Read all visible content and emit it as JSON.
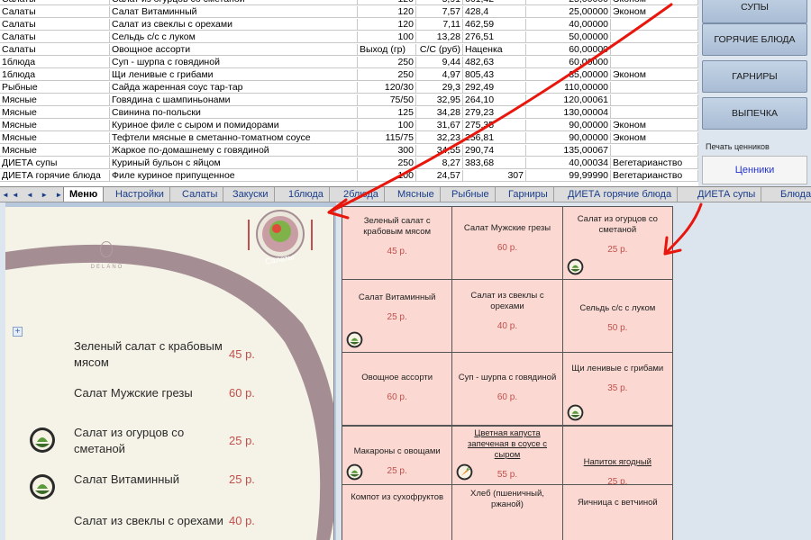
{
  "sheet": {
    "rows": [
      [
        "Салаты",
        "Салат из огурцов со сметаной",
        "120",
        "5,91",
        "661,42",
        "25,00000",
        "Эконом"
      ],
      [
        "Салаты",
        "Салат Витаминный",
        "120",
        "7,57",
        "428,4",
        "25,00000",
        "Эконом"
      ],
      [
        "Салаты",
        "Салат из свеклы с орехами",
        "120",
        "7,11",
        "462,59",
        "40,00000",
        ""
      ],
      [
        "Салаты",
        "Сельдь с/с с луком",
        "100",
        "13,28",
        "276,51",
        "50,00000",
        ""
      ],
      [
        "Салаты",
        "Овощное ассорти",
        "Выход (гр)",
        "С/С (руб)",
        "Наценка",
        "60,00000",
        ""
      ],
      [
        "1блюда",
        "Суп - шурпа с говядиной",
        "250",
        "9,44",
        "482,63",
        "60,00000",
        ""
      ],
      [
        "1блюда",
        "Щи ленивые с грибами",
        "250",
        "4,97",
        "805,43",
        "35,00000",
        "Эконом"
      ],
      [
        "Рыбные",
        "Сайда жаренная соус тар-тар",
        "120/30",
        "29,3",
        "292,49",
        "110,00000",
        ""
      ],
      [
        "Мясные",
        "Говядина с шампиньонами",
        "75/50",
        "32,95",
        "264,10",
        "120,00061",
        ""
      ],
      [
        "Мясные",
        "Свинина по-польски",
        "125",
        "34,28",
        "279,23",
        "130,00004",
        ""
      ],
      [
        "Мясные",
        "Куриное филе с сыром и помидорами",
        "100",
        "31,67",
        "275,35",
        "90,00000",
        "Эконом"
      ],
      [
        "Мясные",
        "Тефтели мясные в сметанно-томатном соусе",
        "115/75",
        "32,23",
        "256,81",
        "90,00000",
        "Эконом"
      ],
      [
        "Мясные",
        "Жаркое по-домашнему с говядиной",
        "300",
        "34,55",
        "290,74",
        "135,00067",
        ""
      ],
      [
        "ДИЕТА супы",
        "Куриный бульон с яйцом",
        "250",
        "8,27",
        "383,68",
        "40,00034",
        "Вегетарианство"
      ],
      [
        "ДИЕТА горячие блюда",
        "Филе куриное припущенное",
        "100",
        "24,57",
        "307",
        "99,99990",
        "Вегетарианство"
      ]
    ]
  },
  "side_buttons": [
    "СУПЫ",
    "ГОРЯЧИЕ БЛЮДА",
    "ГАРНИРЫ",
    "ВЫПЕЧКА"
  ],
  "price_tags": {
    "caption": "Печать ценников",
    "button": "Ценники"
  },
  "tabs": {
    "nav": "◄◄ ◄ ► ►►",
    "items": [
      "Меню",
      "Настройки",
      "Салаты",
      "Закуски",
      "1блюда",
      "2блюда",
      "Мясные",
      "Рыбные",
      "Гарниры",
      "ДИЕТА горячие блюда",
      "ДИЕТА супы",
      "Блюда"
    ],
    "active": "Меню"
  },
  "menu": {
    "logo_text": "DELANO",
    "badge": "Салаты",
    "items": [
      {
        "name": "Зеленый салат с крабовым мясом",
        "price": "45 р."
      },
      {
        "name": "Салат Мужские грезы",
        "price": "60 р."
      },
      {
        "name": "Салат из огурцов со сметаной",
        "price": "25 р."
      },
      {
        "name": "Салат Витаминный",
        "price": "25 р."
      },
      {
        "name": "Салат из свеклы с орехами",
        "price": "40 р."
      }
    ]
  },
  "cards_top": [
    {
      "name": "Зеленый салат с крабовым мясом",
      "price": "45 р."
    },
    {
      "name": "Салат Мужские грезы",
      "price": "60 р."
    },
    {
      "name": "Салат из огурцов со сметаной",
      "price": "25 р."
    },
    {
      "name": "Салат Витаминный",
      "price": "25 р."
    },
    {
      "name": "Салат из свеклы с орехами",
      "price": "40 р."
    },
    {
      "name": "Сельдь с/с с луком",
      "price": "50 р."
    },
    {
      "name": "Овощное ассорти",
      "price": "60 р."
    },
    {
      "name": "Суп - шурпа с говядиной",
      "price": "60 р."
    },
    {
      "name": "Щи ленивые с грибами",
      "price": "35 р."
    }
  ],
  "cards_bottom": [
    {
      "name": "Макароны с овощами",
      "price": "25 р."
    },
    {
      "name": "Цветная капуста запеченая в соусе с сыром",
      "price": "55 р."
    },
    {
      "name": "Напиток ягодный",
      "price": "25 р."
    },
    {
      "name": "Компот из сухофруктов",
      "price": ""
    },
    {
      "name": "Хлеб (пшеничный, ржаной)",
      "price": ""
    },
    {
      "name": "Яичница с ветчиной",
      "price": ""
    }
  ],
  "colors": {
    "price": "#c0504d",
    "card_bg": "#fbd9d2",
    "arrow": "#e8160c",
    "menu_bg": "#f5f3e7",
    "ring": "#a48e94"
  },
  "icons": {
    "veg_badge": "bowl-icon",
    "diet_badge": "carrot-icon"
  }
}
